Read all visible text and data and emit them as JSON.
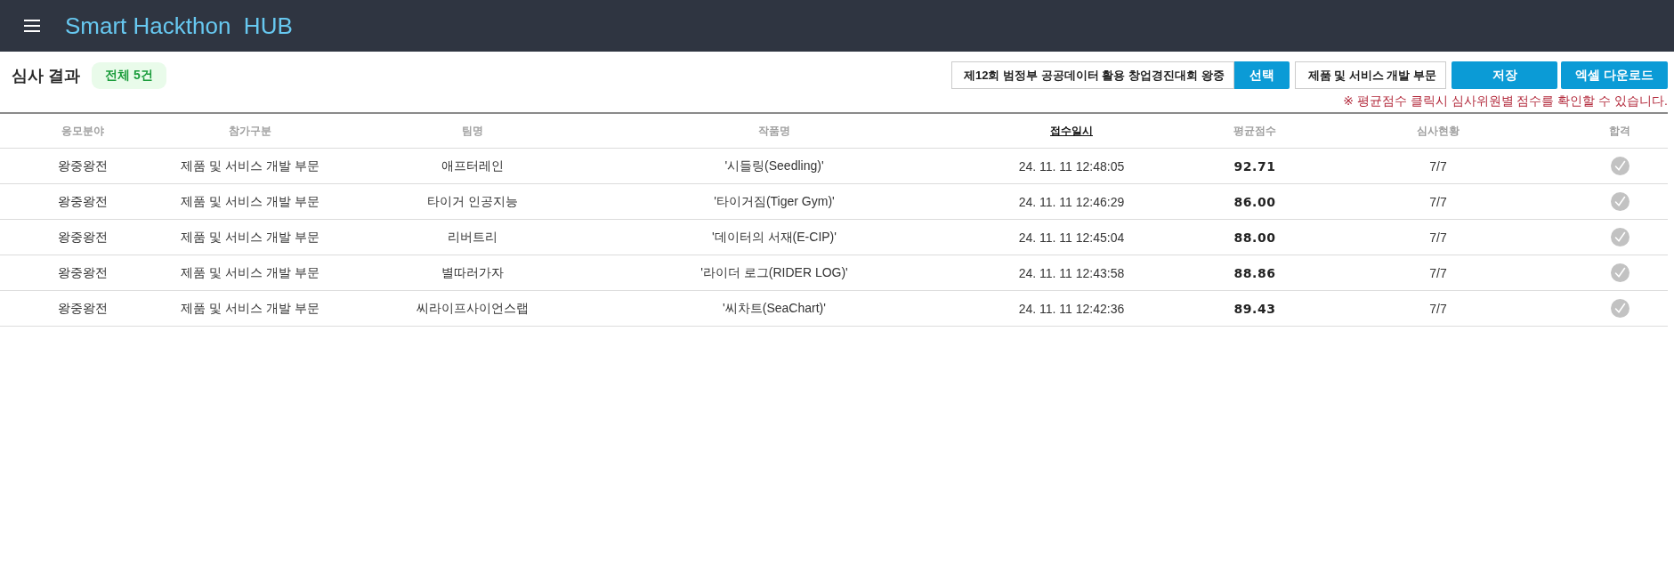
{
  "header": {
    "title": "Smart Hackthon  HUB"
  },
  "page": {
    "title": "심사 결과",
    "count_badge": "전체 5건"
  },
  "filters": {
    "contest": {
      "value": "제12회 범정부 공공데이터 활용 창업경진대회 왕중"
    },
    "select_button": "선택",
    "category": {
      "value": "제품 및 서비스 개발 부문"
    },
    "save_button": "저장",
    "excel_button": "엑셀 다운로드",
    "notice": "※ 평균점수 클릭시 심사위원별 점수를 확인할 수 있습니다."
  },
  "table": {
    "columns": [
      {
        "label": "응모분야",
        "sorted": false
      },
      {
        "label": "참가구분",
        "sorted": false
      },
      {
        "label": "팀명",
        "sorted": false
      },
      {
        "label": "작품명",
        "sorted": false
      },
      {
        "label": "접수일시",
        "sorted": true
      },
      {
        "label": "평균점수",
        "sorted": false
      },
      {
        "label": "심사현황",
        "sorted": false
      },
      {
        "label": "합격",
        "sorted": false
      }
    ],
    "rows": [
      {
        "field": "왕중왕전",
        "category": "제품 및 서비스 개발 부문",
        "team": "애프터레인",
        "work": "'시들링(Seedling)'",
        "received": "24. 11. 11 12:48:05",
        "average": "92.71",
        "status": "7/7",
        "passed": true
      },
      {
        "field": "왕중왕전",
        "category": "제품 및 서비스 개발 부문",
        "team": "타이거 인공지능",
        "work": "'타이거짐(Tiger Gym)'",
        "received": "24. 11. 11 12:46:29",
        "average": "86.00",
        "status": "7/7",
        "passed": true
      },
      {
        "field": "왕중왕전",
        "category": "제품 및 서비스 개발 부문",
        "team": "리버트리",
        "work": "'데이터의 서재(E-CIP)'",
        "received": "24. 11. 11 12:45:04",
        "average": "88.00",
        "status": "7/7",
        "passed": true
      },
      {
        "field": "왕중왕전",
        "category": "제품 및 서비스 개발 부문",
        "team": "별따러가자",
        "work": "'라이더 로그(RIDER LOG)'",
        "received": "24. 11. 11 12:43:58",
        "average": "88.86",
        "status": "7/7",
        "passed": true
      },
      {
        "field": "왕중왕전",
        "category": "제품 및 서비스 개발 부문",
        "team": "씨라이프사이언스랩",
        "work": "'씨차트(SeaChart)'",
        "received": "24. 11. 11 12:42:36",
        "average": "89.43",
        "status": "7/7",
        "passed": true
      }
    ]
  }
}
